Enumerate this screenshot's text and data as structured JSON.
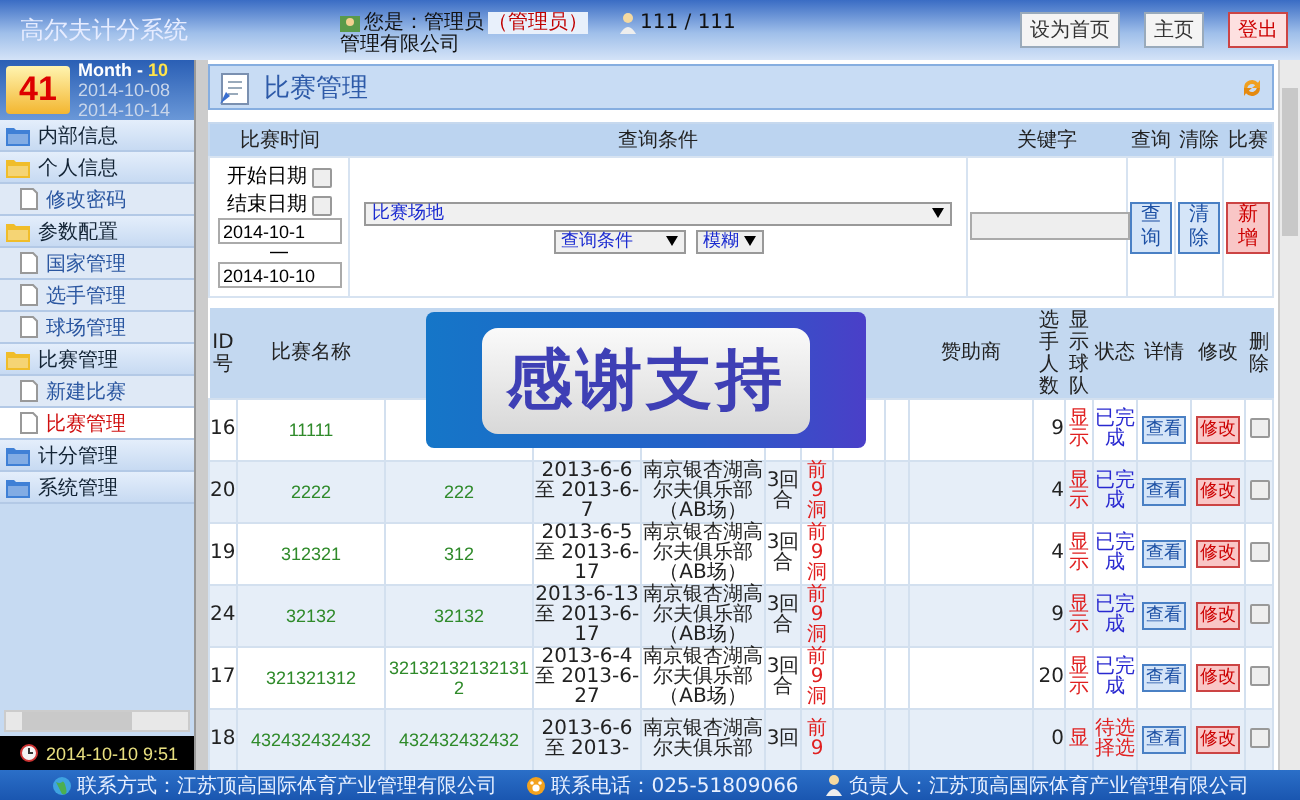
{
  "header": {
    "title": "高尔夫计分系统",
    "user": "您是：管理员",
    "role": "（管理员）",
    "company": "管理有限公司",
    "counter": "111 / 111",
    "buttons": [
      {
        "label": "设为首页",
        "kind": "normal"
      },
      {
        "label": "主页",
        "kind": "normal"
      },
      {
        "label": "登出",
        "kind": "danger"
      }
    ]
  },
  "calendar": {
    "day": "41",
    "month_label": "Month - ",
    "month": "10",
    "start": "2014-10-08",
    "end": "2014-10-14"
  },
  "menu": [
    {
      "label": "内部信息",
      "expanded": false
    },
    {
      "label": "个人信息",
      "expanded": true,
      "children": [
        {
          "label": "修改密码",
          "selected": false
        }
      ]
    },
    {
      "label": "参数配置",
      "expanded": true,
      "children": [
        {
          "label": "国家管理",
          "selected": false
        },
        {
          "label": "选手管理",
          "selected": false
        },
        {
          "label": "球场管理",
          "selected": false
        }
      ]
    },
    {
      "label": "比赛管理",
      "expanded": true,
      "children": [
        {
          "label": "新建比赛",
          "selected": false
        },
        {
          "label": "比赛管理",
          "selected": true
        }
      ]
    },
    {
      "label": "计分管理",
      "expanded": false
    },
    {
      "label": "系统管理",
      "expanded": false
    }
  ],
  "clock": "2014-10-10 9:51",
  "page_title": "比赛管理",
  "search": {
    "columns": [
      "比赛时间",
      "查询条件",
      "关键字",
      "查询",
      "清除",
      "比赛"
    ],
    "start_label": "开始日期",
    "start_checked": false,
    "end_label": "结束日期",
    "end_checked": false,
    "date_from": "2014-10-1",
    "date_sep": "—",
    "date_to": "2014-10-10",
    "venue_select": "比赛场地",
    "condition_select": "查询条件",
    "match_select": "模糊",
    "buttons": [
      {
        "label": "查询",
        "kind": "blue"
      },
      {
        "label": "清除",
        "kind": "blue"
      },
      {
        "label": "新增",
        "kind": "red"
      }
    ]
  },
  "table": {
    "columns": [
      "ID号",
      "比赛名称",
      "赞助商",
      "选手人数",
      "显示球队",
      "状态",
      "详情",
      "修改",
      "删除"
    ],
    "rows": [
      {
        "id": "16",
        "name": "11111",
        "players": "9",
        "team": "显示",
        "status": "已完成",
        "color": "#2828d0",
        "view": "查看",
        "edit": "修改",
        "checked": false
      },
      {
        "id": "20",
        "name": "2222",
        "short": "222",
        "time": "2013-6-6 至 2013-6-7",
        "venue": "南京银杏湖高尔夫俱乐部（AB场）",
        "rounds": "3回合",
        "holes": "前9洞",
        "players": "4",
        "team": "显示",
        "status": "已完成",
        "color": "#2828d0",
        "view": "查看",
        "edit": "修改",
        "checked": false
      },
      {
        "id": "19",
        "name": "312321",
        "short": "312",
        "time": "2013-6-5 至 2013-6-17",
        "venue": "南京银杏湖高尔夫俱乐部（AB场）",
        "rounds": "3回合",
        "holes": "前9洞",
        "players": "4",
        "team": "显示",
        "status": "已完成",
        "color": "#2828d0",
        "view": "查看",
        "edit": "修改",
        "checked": false
      },
      {
        "id": "24",
        "name": "32132",
        "short": "32132",
        "time": "2013-6-13 至 2013-6-17",
        "venue": "南京银杏湖高尔夫俱乐部（AB场）",
        "rounds": "3回合",
        "holes": "前9洞",
        "players": "9",
        "team": "显示",
        "status": "已完成",
        "color": "#2828d0",
        "view": "查看",
        "edit": "修改",
        "checked": false
      },
      {
        "id": "17",
        "name": "321321312",
        "short": "321321321321312",
        "time": "2013-6-4 至 2013-6-27",
        "venue": "南京银杏湖高尔夫俱乐部（AB场）",
        "rounds": "3回合",
        "holes": "前9洞",
        "players": "20",
        "team": "显示",
        "status": "已完成",
        "color": "#2828d0",
        "view": "查看",
        "edit": "修改",
        "checked": false
      },
      {
        "id": "18",
        "name": "432432432432",
        "short": "432432432432",
        "time": "2013-6-6 至 2013-",
        "venue": "南京银杏湖高尔夫俱乐部",
        "rounds": "3回",
        "holes": "前9",
        "players": "0",
        "team": "显",
        "status": "待选择选",
        "color": "#e02020",
        "view": "查看",
        "edit": "修改",
        "checked": false
      }
    ]
  },
  "overlay": {
    "text": "感谢支持"
  },
  "footer": [
    {
      "kind": "contact",
      "label": "联系方式：江苏顶高国际体育产业管理有限公司"
    },
    {
      "kind": "phone",
      "label": "联系电话：025-51809066"
    },
    {
      "kind": "person",
      "label": "负责人：江苏顶高国际体育产业管理有限公司"
    }
  ]
}
